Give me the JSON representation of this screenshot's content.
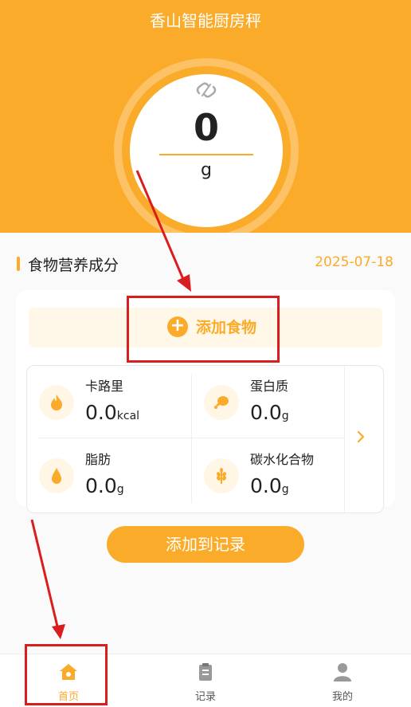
{
  "header": {
    "title": "香山智能厨房秤"
  },
  "scale": {
    "weight": "0",
    "unit": "g",
    "status_icon": "link-broken-icon"
  },
  "section": {
    "title": "食物营养成分",
    "date": "2025-07-18"
  },
  "add_food": {
    "label": "添加食物",
    "icon": "plus-circle-icon"
  },
  "nutrition": [
    {
      "label": "卡路里",
      "value": "0.0",
      "unit": "kcal",
      "icon": "flame-icon"
    },
    {
      "label": "蛋白质",
      "value": "0.0",
      "unit": "g",
      "icon": "drumstick-icon"
    },
    {
      "label": "脂肪",
      "value": "0.0",
      "unit": "g",
      "icon": "droplet-icon"
    },
    {
      "label": "碳水化合物",
      "value": "0.0",
      "unit": "g",
      "icon": "wheat-icon"
    }
  ],
  "add_record": {
    "label": "添加到记录"
  },
  "tabs": [
    {
      "label": "首页",
      "icon": "home-icon",
      "active": true
    },
    {
      "label": "记录",
      "icon": "clipboard-icon",
      "active": false
    },
    {
      "label": "我的",
      "icon": "user-icon",
      "active": false
    }
  ],
  "colors": {
    "accent": "#fbab2a",
    "annotation": "#d81e1e"
  }
}
